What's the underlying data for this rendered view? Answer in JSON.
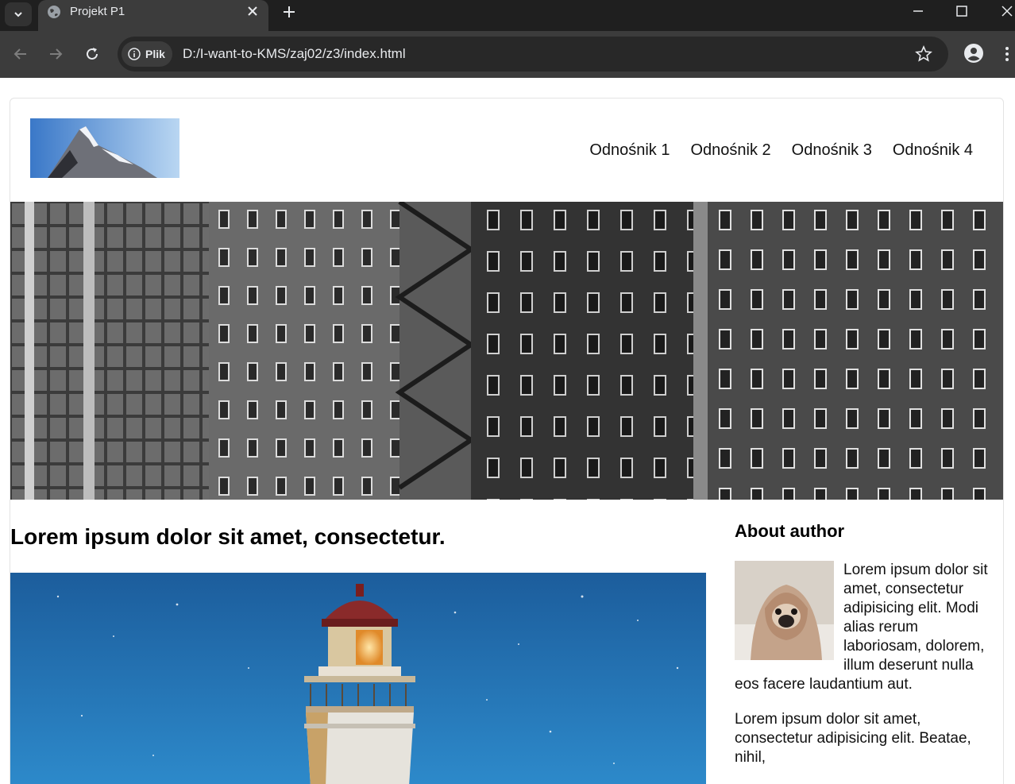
{
  "browser": {
    "tab_title": "Projekt P1",
    "site_info_label": "Plik",
    "url": "D:/I-want-to-KMS/zaj02/z3/index.html"
  },
  "page": {
    "nav": [
      "Odnośnik 1",
      "Odnośnik 2",
      "Odnośnik 3",
      "Odnośnik 4"
    ],
    "article_title": "Lorem ipsum dolor sit amet, consectetur.",
    "aside": {
      "title": "About author",
      "paragraph1": "Lorem ipsum dolor sit amet, consectetur adipisicing elit. Modi alias rerum laboriosam, dolorem, illum deserunt nulla eos facere laudantium aut.",
      "paragraph2": "Lorem ipsum dolor sit amet, consectetur adipisicing elit. Beatae, nihil,"
    }
  },
  "colors": {
    "chrome_bg": "#1f1f1f",
    "toolbar_bg": "#3c3c3c",
    "omnibox_bg": "#282828"
  }
}
